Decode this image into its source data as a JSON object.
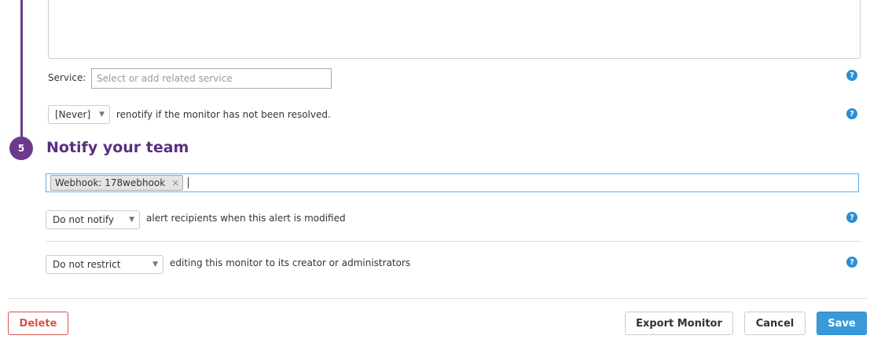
{
  "service": {
    "label": "Service:",
    "placeholder": "Select or add related service"
  },
  "renotify": {
    "selected": "[Never]",
    "text": "renotify if the monitor has not been resolved."
  },
  "step": {
    "number": "5",
    "title": "Notify your team"
  },
  "recipients": {
    "tags": [
      "Webhook: 178webhook"
    ],
    "remove_glyph": "×"
  },
  "notify_on_modify": {
    "selected": "Do not notify",
    "text": "alert recipients when this alert is modified"
  },
  "restrict": {
    "selected": "Do not restrict",
    "text": "editing this monitor to its creator or administrators"
  },
  "help_glyph": "?",
  "buttons": {
    "delete": "Delete",
    "export": "Export Monitor",
    "cancel": "Cancel",
    "save": "Save"
  },
  "colors": {
    "accent_purple": "#6b3a8e",
    "primary_blue": "#3a9ad9",
    "danger_red": "#d9534f"
  },
  "icons": {
    "help": "help-circle-icon",
    "caret": "caret-down-icon",
    "remove": "close-icon"
  }
}
